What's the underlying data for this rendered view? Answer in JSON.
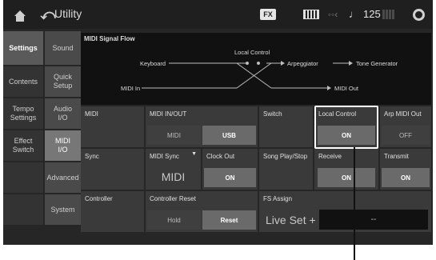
{
  "header": {
    "title": "Utility",
    "fx_badge": "FX",
    "tempo": "125",
    "tempo_note": "♩"
  },
  "sidebar_primary": [
    {
      "label": "Settings",
      "active": true
    },
    {
      "label": "Contents",
      "active": false
    },
    {
      "label": "Tempo Settings",
      "active": false
    },
    {
      "label": "Effect Switch",
      "active": false
    },
    {
      "label": "",
      "active": false
    },
    {
      "label": "",
      "active": false
    }
  ],
  "sidebar_secondary": [
    {
      "label": "Sound",
      "active": false
    },
    {
      "label": "Quick Setup",
      "active": false
    },
    {
      "label": "Audio I/O",
      "active": false
    },
    {
      "label": "MIDI I/O",
      "active": true
    },
    {
      "label": "Advanced",
      "active": false
    },
    {
      "label": "System",
      "active": false
    }
  ],
  "diagram": {
    "title": "MIDI Signal Flow",
    "keyboard": "Keyboard",
    "local_control": "Local Control",
    "arpeggiator": "Arpeggiator",
    "tone_generator": "Tone Generator",
    "midi_in": "MIDI In",
    "midi_out": "MIDI Out"
  },
  "midi_row": {
    "section": "MIDI",
    "in_out_label": "MIDI IN/OUT",
    "in_out_options": [
      "MIDI",
      "USB"
    ],
    "in_out_selected": "USB",
    "switch_label": "Switch",
    "local_control_label": "Local Control",
    "local_control_value": "ON",
    "arp_out_label": "Arp MIDI Out",
    "arp_out_value": "OFF"
  },
  "sync_row": {
    "section": "Sync",
    "midi_sync_label": "MIDI Sync",
    "midi_sync_value": "MIDI",
    "clock_out_label": "Clock Out",
    "clock_out_value": "ON",
    "song_play_label": "Song Play/Stop",
    "receive_label": "Receive",
    "receive_value": "ON",
    "transmit_label": "Transmit",
    "transmit_value": "ON"
  },
  "controller_row": {
    "section": "Controller",
    "reset_label": "Controller Reset",
    "reset_options": [
      "Hold",
      "Reset"
    ],
    "reset_selected": "Reset",
    "fs_assign_label": "FS Assign",
    "fs_assign_value": "Live Set +",
    "fs_assign_extra": "--"
  }
}
